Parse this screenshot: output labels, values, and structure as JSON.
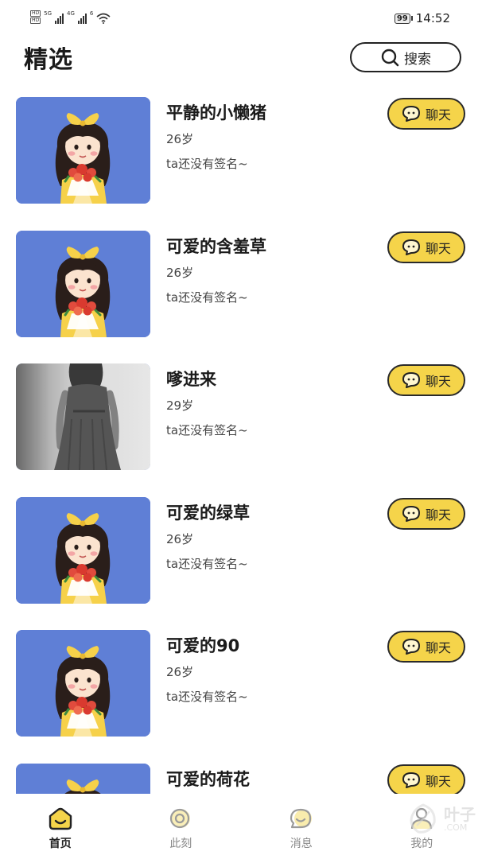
{
  "status_bar": {
    "hd1": "HD",
    "hd2": "HD",
    "net1": "5G",
    "net2": "4G",
    "wifi_label": "6",
    "battery": "99",
    "time": "14:52"
  },
  "header": {
    "title": "精选",
    "search_label": "搜索"
  },
  "users": [
    {
      "name": "平静的小懒猪",
      "age": "26岁",
      "signature": "ta还没有签名~",
      "chat_label": "聊天",
      "avatar": "cartoon-girl"
    },
    {
      "name": "可爱的含羞草",
      "age": "26岁",
      "signature": "ta还没有签名~",
      "chat_label": "聊天",
      "avatar": "cartoon-girl"
    },
    {
      "name": "嗲进来",
      "age": "29岁",
      "signature": "ta还没有签名~",
      "chat_label": "聊天",
      "avatar": "photo-girl-dress"
    },
    {
      "name": "可爱的绿草",
      "age": "26岁",
      "signature": "ta还没有签名~",
      "chat_label": "聊天",
      "avatar": "cartoon-girl"
    },
    {
      "name": "可爱的90",
      "age": "26岁",
      "signature": "ta还没有签名~",
      "chat_label": "聊天",
      "avatar": "cartoon-girl"
    },
    {
      "name": "可爱的荷花",
      "age": "",
      "signature": "",
      "chat_label": "聊天",
      "avatar": "cartoon-girl"
    }
  ],
  "nav": [
    {
      "label": "首页",
      "icon": "home-icon",
      "active": true
    },
    {
      "label": "此刻",
      "icon": "moment-icon",
      "active": false
    },
    {
      "label": "消息",
      "icon": "message-icon",
      "active": false
    },
    {
      "label": "我的",
      "icon": "profile-icon",
      "active": false
    }
  ],
  "watermark": {
    "text": "叶子",
    "sub": ".COM"
  },
  "colors": {
    "accent_yellow": "#f5d44a",
    "avatar_bg": "#5f7fd6",
    "text_dark": "#1a1a1a"
  }
}
